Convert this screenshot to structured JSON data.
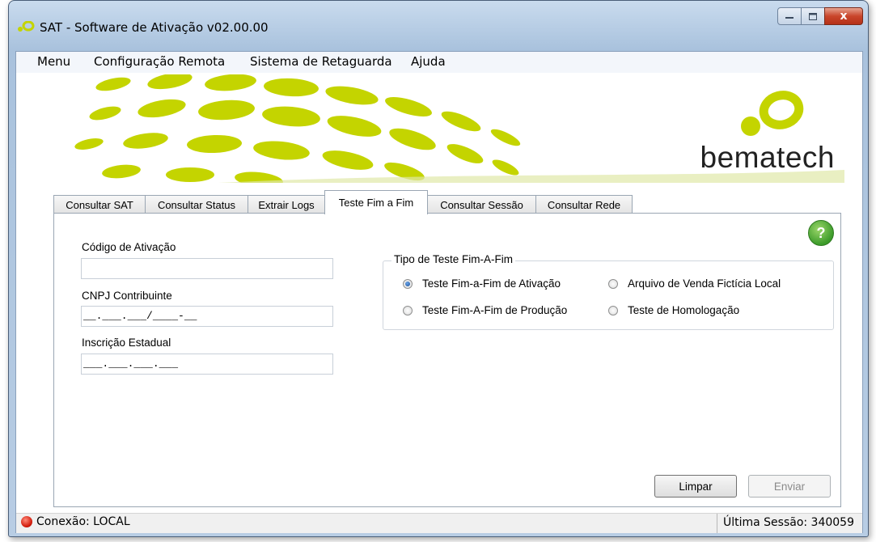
{
  "window": {
    "title": "SAT - Software de Ativação v02.00.00",
    "close_glyph": "x",
    "min_glyph": "-",
    "max_glyph": "□"
  },
  "menu": [
    "Menu",
    "Configuração Remota",
    "Sistema de Retaguarda",
    "Ajuda"
  ],
  "banner": {
    "brand": "bematech",
    "accent_color": "#c4d400"
  },
  "tabs": [
    "Consultar SAT",
    "Consultar Status",
    "Extrair Logs",
    "Teste Fim a Fim",
    "Consultar Sessão",
    "Consultar Rede"
  ],
  "active_tab": "Teste Fim a Fim",
  "form": {
    "help_glyph": "?",
    "codigo_label": "Código de Ativação",
    "codigo_value": "",
    "cnpj_label": "CNPJ Contribuinte",
    "cnpj_value": "__.___.___/____-__",
    "ie_label": "Inscrição Estadual",
    "ie_value": "___.___.___.___"
  },
  "test_type": {
    "title": "Tipo de Teste Fim-A-Fim",
    "options": [
      {
        "label": "Teste Fim-a-Fim de Ativação",
        "selected": true
      },
      {
        "label": "Arquivo de Venda Fictícia Local",
        "selected": false
      },
      {
        "label": "Teste Fim-A-Fim de Produção",
        "selected": false
      },
      {
        "label": "Teste de Homologação",
        "selected": false
      }
    ]
  },
  "buttons": {
    "clear": "Limpar",
    "send": "Enviar"
  },
  "status": {
    "connection": "Conexão: LOCAL",
    "last_session": "Última Sessão: 340059",
    "led_color": "#d11a0a"
  }
}
